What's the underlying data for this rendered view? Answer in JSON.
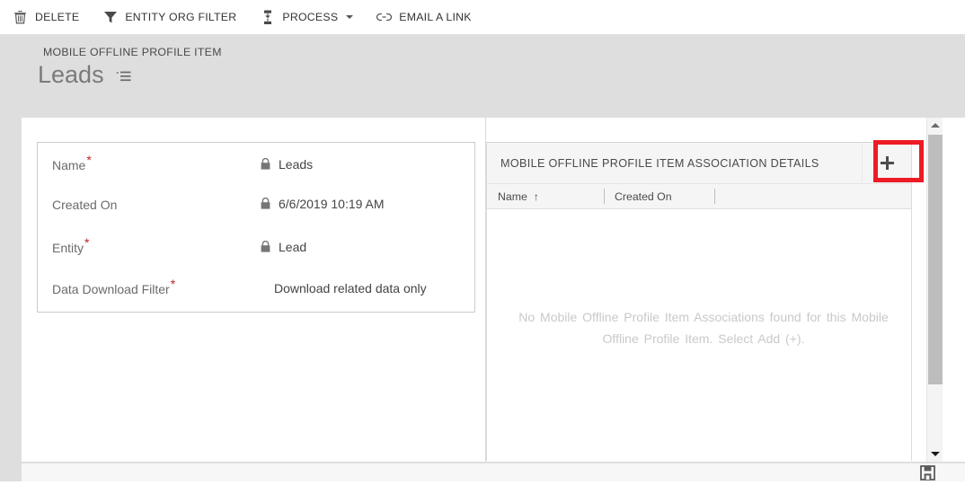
{
  "commandbar": {
    "items": [
      {
        "icon": "trash-icon",
        "label": "DELETE",
        "has_caret": false
      },
      {
        "icon": "funnel-icon",
        "label": "ENTITY ORG FILTER",
        "has_caret": false
      },
      {
        "icon": "process-icon",
        "label": "PROCESS",
        "has_caret": true
      },
      {
        "icon": "link-icon",
        "label": "EMAIL A LINK",
        "has_caret": false
      }
    ]
  },
  "header": {
    "breadcrumb": "MOBILE OFFLINE PROFILE ITEM",
    "record_title": "Leads",
    "nav_icon": "record-set-navigator-icon"
  },
  "form": {
    "fields": [
      {
        "label": "Name",
        "required": true,
        "locked": true,
        "value": "Leads"
      },
      {
        "label": "Created On",
        "required": false,
        "locked": true,
        "value": "6/6/2019   10:19 AM"
      },
      {
        "label": "Entity",
        "required": true,
        "locked": true,
        "value": "Lead"
      },
      {
        "label": "Data Download Filter",
        "required": true,
        "locked": false,
        "value": "Download related data only"
      }
    ]
  },
  "subgrid": {
    "title": "MOBILE OFFLINE PROFILE ITEM ASSOCIATION DETAILS",
    "add_label": "+",
    "columns": [
      {
        "label": "Name",
        "sorted": true,
        "sort_glyph": "↑"
      },
      {
        "label": "Created On",
        "sorted": false,
        "sort_glyph": ""
      }
    ],
    "empty_message": "No Mobile Offline Profile Item Associations found for this Mobile Offline Profile Item. Select Add (+)."
  },
  "statusbar": {
    "save_icon": "save-floppy-icon"
  },
  "annotation": {
    "color": "#ed1b24",
    "target": "add-association-button"
  }
}
